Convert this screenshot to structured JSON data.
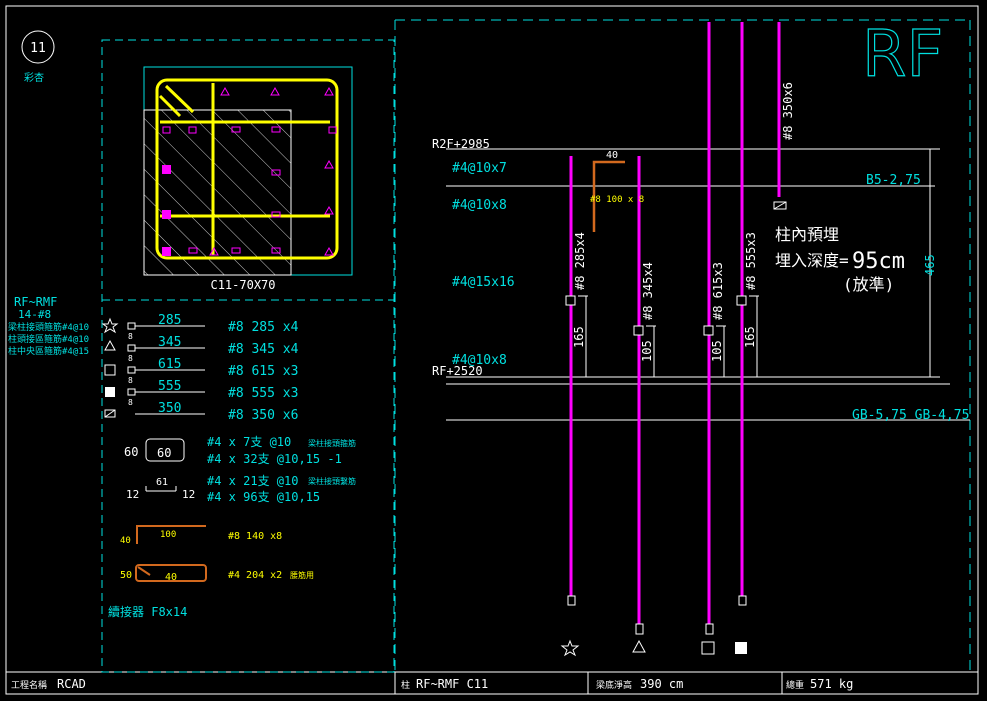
{
  "colors": {
    "cyan": "#00e0e0",
    "white": "#ffffff",
    "yellow": "#ffff00",
    "magenta": "#ff00ff",
    "orange": "#d2691e",
    "background": "#000000"
  },
  "badge": {
    "number": "11",
    "subtitle": "彩杏"
  },
  "section": {
    "label": "C11-70X70"
  },
  "big_title": "RF",
  "left_labels": {
    "range": "RF~RMF",
    "line2": "14-#8",
    "lines": [
      "梁柱接頭箍筋#4@10",
      "柱頭接區箍筋#4@10",
      "柱中央區箍筋#4@15"
    ]
  },
  "bars": [
    {
      "sym": "star-icon",
      "len": "285",
      "desc": "#8 285 x4"
    },
    {
      "sym": "triangle-icon",
      "len": "345",
      "desc": "#8 345 x4"
    },
    {
      "sym": "square-open-icon",
      "len": "615",
      "desc": "#8 615 x3"
    },
    {
      "sym": "square-filled-icon",
      "len": "555",
      "desc": "#8 555 x3"
    },
    {
      "sym": "square-hatched-icon",
      "len": "350",
      "desc": "#8 350 x6"
    }
  ],
  "hook_small": "8",
  "stirrups": {
    "a_dim": "60",
    "a_box": "60",
    "a1": "#4 x   7支 @10",
    "a1_note": "梁柱接頭箍筋",
    "a2": "#4 x 32支 @10,15 -1",
    "b_top": "61",
    "b_left": "12",
    "b_right": "12",
    "b1": "#4 x 21支 @10",
    "b1_note": "梁柱接頭繫筋",
    "b2": "#4 x 96支 @10,15"
  },
  "l_bar": {
    "top": "100",
    "left": "40",
    "desc": "#8 140 x8"
  },
  "u_bar": {
    "left": "50",
    "inner": "40",
    "desc": "#4 204 x2",
    "note": "腰筋用"
  },
  "coupler": "續接器 F8x14",
  "elevation": {
    "r2f": "R2F+2985",
    "rf": "RF+2520",
    "b5": "B5-2,75",
    "gb": "GB-5,75  GB-4,75",
    "ties": [
      "#4@10x7",
      "#4@10x8",
      "#4@15x16",
      "#4@10x8"
    ],
    "dims": {
      "d465": "465",
      "d165a": "165",
      "d105a": "105",
      "d105b": "105",
      "d165b": "165",
      "top40": "40"
    },
    "bar_labels": [
      "#8 285x4",
      "#8 345x4",
      "#8 615x3",
      "#8 555x3",
      "#8 350x6"
    ],
    "hook_note": "#8 100 x 8",
    "embed1": "柱內預埋",
    "embed2": "埋入深度=",
    "embed_val": "95cm",
    "embed3": "(放準)"
  },
  "footer": {
    "project_label": "工程名稱",
    "project": "RCAD",
    "column_label": "柱",
    "column": "RF~RMF C11",
    "height_label": "梁底淨高",
    "height": "390 cm",
    "weight_label": "總重",
    "weight": "571 kg"
  }
}
